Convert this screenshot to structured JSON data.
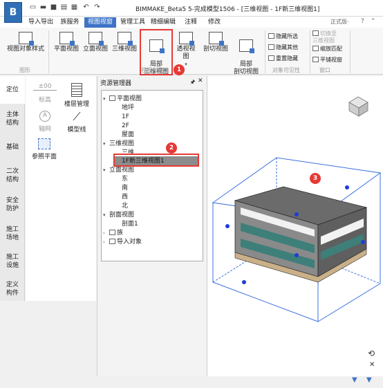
{
  "app": {
    "logo_text": "B",
    "title": "BIMMAKE_Beta5 5-完成模型1506 - [三维视图 - 1F新三维视图1]",
    "version": "正式版·"
  },
  "quick_access": [
    "new-file-icon",
    "open-folder-icon",
    "save-icon",
    "export-icon",
    "print-icon",
    "undo-icon",
    "redo-icon"
  ],
  "tabs": [
    {
      "label": "导入导出"
    },
    {
      "label": "族服务"
    },
    {
      "label": "视图视窗"
    },
    {
      "label": "管理工具"
    },
    {
      "label": "精细编辑"
    },
    {
      "label": "注释"
    },
    {
      "label": "修改"
    }
  ],
  "ribbon": {
    "buttons": [
      {
        "label": "视图对象样式"
      },
      {
        "label": "平面视图"
      },
      {
        "label": "立面视图"
      },
      {
        "label": "三维视图"
      },
      {
        "label": "局部\n三维视图"
      },
      {
        "label": "透视视图"
      },
      {
        "label": "剖切视图"
      },
      {
        "label": "局部\n剖切视图"
      }
    ],
    "small_buttons": [
      {
        "label": "隐藏所选"
      },
      {
        "label": "隐藏其他"
      },
      {
        "label": "重置隐藏"
      },
      {
        "label": "切换至\n三维视图"
      },
      {
        "label": "缩放匹配"
      },
      {
        "label": "平铺视窗"
      }
    ],
    "groups": {
      "graphics": "图形",
      "view_create": "视图创建",
      "visibility": "对象可见性",
      "window": "窗口"
    }
  },
  "left_tabs": [
    {
      "label": "定位"
    },
    {
      "label": "主体\n结构"
    },
    {
      "label": "基础"
    },
    {
      "label": "二次\n结构"
    },
    {
      "label": "安全\n防护"
    },
    {
      "label": "施工\n场地"
    },
    {
      "label": "施工\n设施"
    },
    {
      "label": "定义\n构件"
    }
  ],
  "tools": {
    "elevation_value": "±00",
    "elevation": "标高",
    "floor_mgmt": "楼层管理",
    "axis_net": "轴网",
    "axis_symbol": "A",
    "model_line": "模型线",
    "ref_plane": "参照平面"
  },
  "resource_manager": {
    "title": "资源管理器",
    "tree": {
      "plan_views": "平面视图",
      "plan_items": [
        "地坪",
        "1F",
        "2F",
        "屋面"
      ],
      "views_3d": "三维视图",
      "views_3d_items": [
        "三维",
        "1F新三维视图1"
      ],
      "elevation_views": "立面视图",
      "elevation_items": [
        "东",
        "南",
        "西",
        "北"
      ],
      "section_views": "剖面视图",
      "section_items": [
        "剖面1"
      ],
      "family": "族",
      "imported": "导入对象"
    }
  },
  "badges": [
    "1",
    "2",
    "3"
  ],
  "colors": {
    "accent": "#3e74c6",
    "highlight": "#e53935",
    "section_box": "#3a6fe0"
  }
}
